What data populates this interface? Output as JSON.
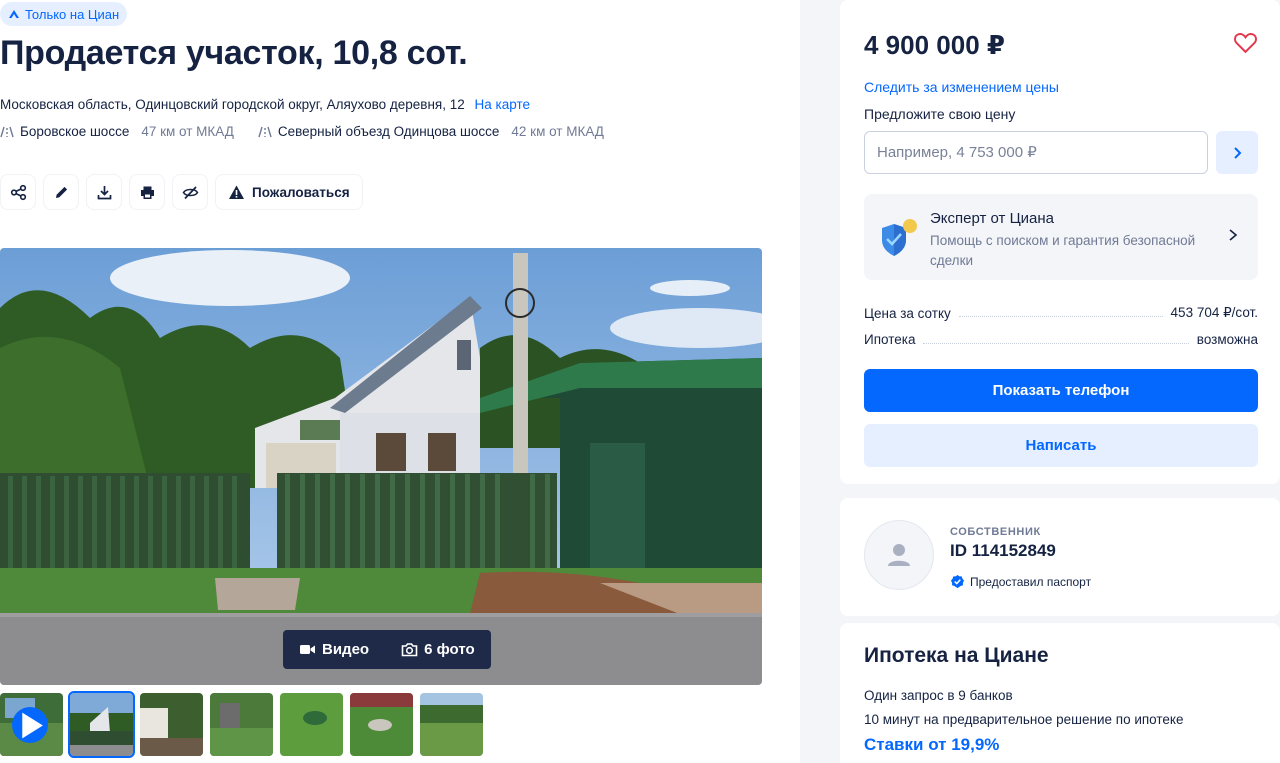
{
  "listing": {
    "badge": "Только на Циан",
    "title": "Продается участок, 10,8 сот.",
    "address": "Московская область, Одинцовский городской округ, Аляухово деревня, 12",
    "map_link": "На карте",
    "highways": [
      {
        "name": "Боровское шоссе",
        "distance": "47 км от МКАД"
      },
      {
        "name": "Северный объезд Одинцова шоссе",
        "distance": "42 км от МКАД"
      }
    ],
    "actions": {
      "share": "share-icon",
      "edit": "pencil-icon",
      "download": "download-icon",
      "print": "printer-icon",
      "hide": "hide-icon",
      "complain_label": "Пожаловаться"
    }
  },
  "gallery": {
    "video_label": "Видео",
    "photo_label": "6 фото",
    "thumbnail_count": 7,
    "active_thumbnail": 2
  },
  "price_card": {
    "price": "4 900 000 ₽",
    "follow_price": "Следить за изменением цены",
    "offer_label": "Предложите свою цену",
    "offer_placeholder": "Например, 4 753 000 ₽",
    "expert_title": "Эксперт от Циана",
    "expert_subtitle": "Помощь с поиском и гарантия безопасной сделки",
    "rows": [
      {
        "label": "Цена за сотку",
        "value": "453 704 ₽/сот."
      },
      {
        "label": "Ипотека",
        "value": "возможна"
      }
    ],
    "show_phone": "Показать телефон",
    "write": "Написать"
  },
  "owner": {
    "role": "СОБСТВЕННИК",
    "id": "ID 114152849",
    "passport": "Предоставил паспорт"
  },
  "mortgage": {
    "title": "Ипотека на Циане",
    "line1": "Один запрос в 9 банков",
    "line2": "10 минут на предварительное решение по ипотеке",
    "rate": "Ставки от 19,9%"
  },
  "colors": {
    "accent": "#0468ff",
    "text": "#152242",
    "muted": "#707a95",
    "light_accent_bg": "#e5efff"
  }
}
